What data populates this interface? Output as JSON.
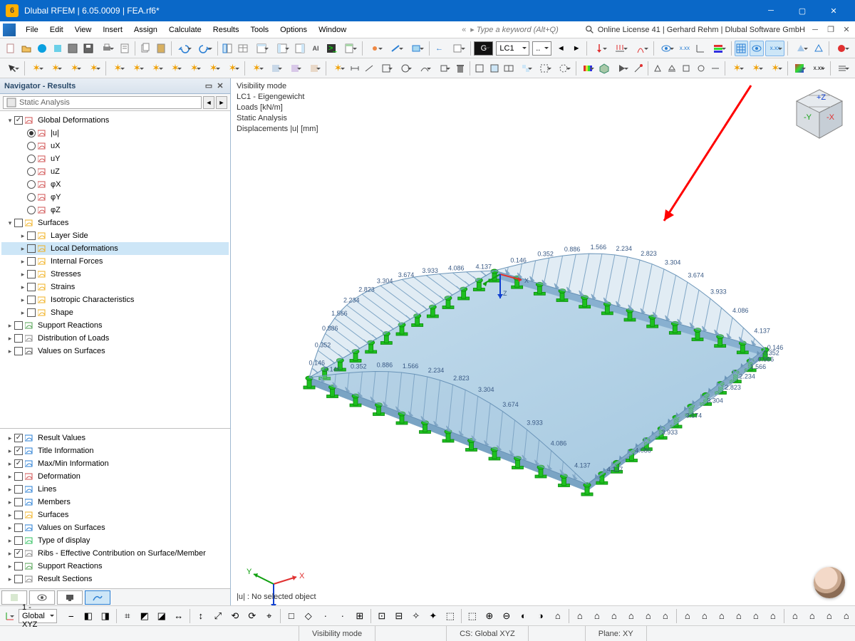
{
  "titlebar": {
    "title": "Dlubal RFEM | 6.05.0009 | FEA.rf6*",
    "app_badge": "6"
  },
  "menubar": {
    "items": [
      "File",
      "Edit",
      "View",
      "Insert",
      "Assign",
      "Calculate",
      "Results",
      "Tools",
      "Options",
      "Window"
    ],
    "search_placeholder": "Type a keyword (Alt+Q)",
    "license": "Online License 41 | Gerhard Rehm | Dlubal Software GmbH"
  },
  "loadcase": {
    "label": "LC1"
  },
  "navigator": {
    "title": "Navigator - Results",
    "analysis_type": "Static Analysis",
    "tree": [
      {
        "lvl": 0,
        "tw": "▾",
        "cb": true,
        "icon": "deform",
        "label": "Global Deformations"
      },
      {
        "lvl": 1,
        "radio": true,
        "sel": true,
        "icon": "deform",
        "label": "|u|"
      },
      {
        "lvl": 1,
        "radio": true,
        "icon": "deform",
        "label": "uX"
      },
      {
        "lvl": 1,
        "radio": true,
        "icon": "deform",
        "label": "uY"
      },
      {
        "lvl": 1,
        "radio": true,
        "icon": "deform",
        "label": "uZ"
      },
      {
        "lvl": 1,
        "radio": true,
        "icon": "deform",
        "label": "φX"
      },
      {
        "lvl": 1,
        "radio": true,
        "icon": "deform",
        "label": "φY"
      },
      {
        "lvl": 1,
        "radio": true,
        "icon": "deform",
        "label": "φZ"
      },
      {
        "lvl": 0,
        "tw": "▾",
        "cb": false,
        "icon": "surf",
        "label": "Surfaces"
      },
      {
        "lvl": 1,
        "tw": "▸",
        "cb": false,
        "icon": "surf",
        "label": "Layer Side"
      },
      {
        "lvl": 1,
        "tw": "▸",
        "cb": false,
        "icon": "surf",
        "label": "Local Deformations",
        "selected": true
      },
      {
        "lvl": 1,
        "tw": "▸",
        "cb": false,
        "icon": "surf",
        "label": "Internal Forces"
      },
      {
        "lvl": 1,
        "tw": "▸",
        "cb": false,
        "icon": "surf",
        "label": "Stresses"
      },
      {
        "lvl": 1,
        "tw": "▸",
        "cb": false,
        "icon": "surf",
        "label": "Strains"
      },
      {
        "lvl": 1,
        "tw": "▸",
        "cb": false,
        "icon": "surf",
        "label": "Isotropic Characteristics"
      },
      {
        "lvl": 1,
        "tw": "▸",
        "cb": false,
        "icon": "surf",
        "label": "Shape"
      },
      {
        "lvl": 0,
        "tw": "▸",
        "cb": false,
        "icon": "react",
        "label": "Support Reactions"
      },
      {
        "lvl": 0,
        "tw": "▸",
        "cb": false,
        "icon": "dist",
        "label": "Distribution of Loads"
      },
      {
        "lvl": 0,
        "tw": "▸",
        "cb": false,
        "icon": "xx",
        "label": "Values on Surfaces"
      }
    ],
    "display_options": [
      {
        "cb": true,
        "icon": "xxx",
        "label": "Result Values"
      },
      {
        "cb": true,
        "icon": "title",
        "label": "Title Information"
      },
      {
        "cb": true,
        "icon": "mm",
        "label": "Max/Min Information"
      },
      {
        "cb": false,
        "icon": "deform",
        "label": "Deformation"
      },
      {
        "cb": false,
        "icon": "lines",
        "label": "Lines"
      },
      {
        "cb": false,
        "icon": "memb",
        "label": "Members"
      },
      {
        "cb": false,
        "icon": "surf",
        "label": "Surfaces"
      },
      {
        "cb": false,
        "icon": "vos",
        "label": "Values on Surfaces"
      },
      {
        "cb": false,
        "icon": "disp",
        "label": "Type of display"
      },
      {
        "cb": true,
        "icon": "ribs",
        "label": "Ribs - Effective Contribution on Surface/Member"
      },
      {
        "cb": false,
        "icon": "react",
        "label": "Support Reactions"
      },
      {
        "cb": false,
        "icon": "sec",
        "label": "Result Sections"
      }
    ]
  },
  "viewport": {
    "overlay": [
      "Visibility mode",
      "LC1 - Eigengewicht",
      "Loads [kN/m]",
      "Static Analysis",
      "Displacements |u| [mm]"
    ],
    "selection": "|u| : No selected object",
    "axes": {
      "x": "X",
      "y": "Y",
      "z": "Z"
    },
    "cube": {
      "x": "-X",
      "y": "-Y",
      "z": "+Z"
    },
    "result_values": [
      "0.146",
      "0.352",
      "0.886",
      "1.566",
      "2.234",
      "2.823",
      "3.304",
      "3.674",
      "3.933",
      "4.086",
      "4.137"
    ]
  },
  "coord": {
    "cs": "1 - Global XYZ"
  },
  "status": {
    "vis": "Visibility mode",
    "cs": "CS: Global XYZ",
    "plane": "Plane: XY"
  }
}
